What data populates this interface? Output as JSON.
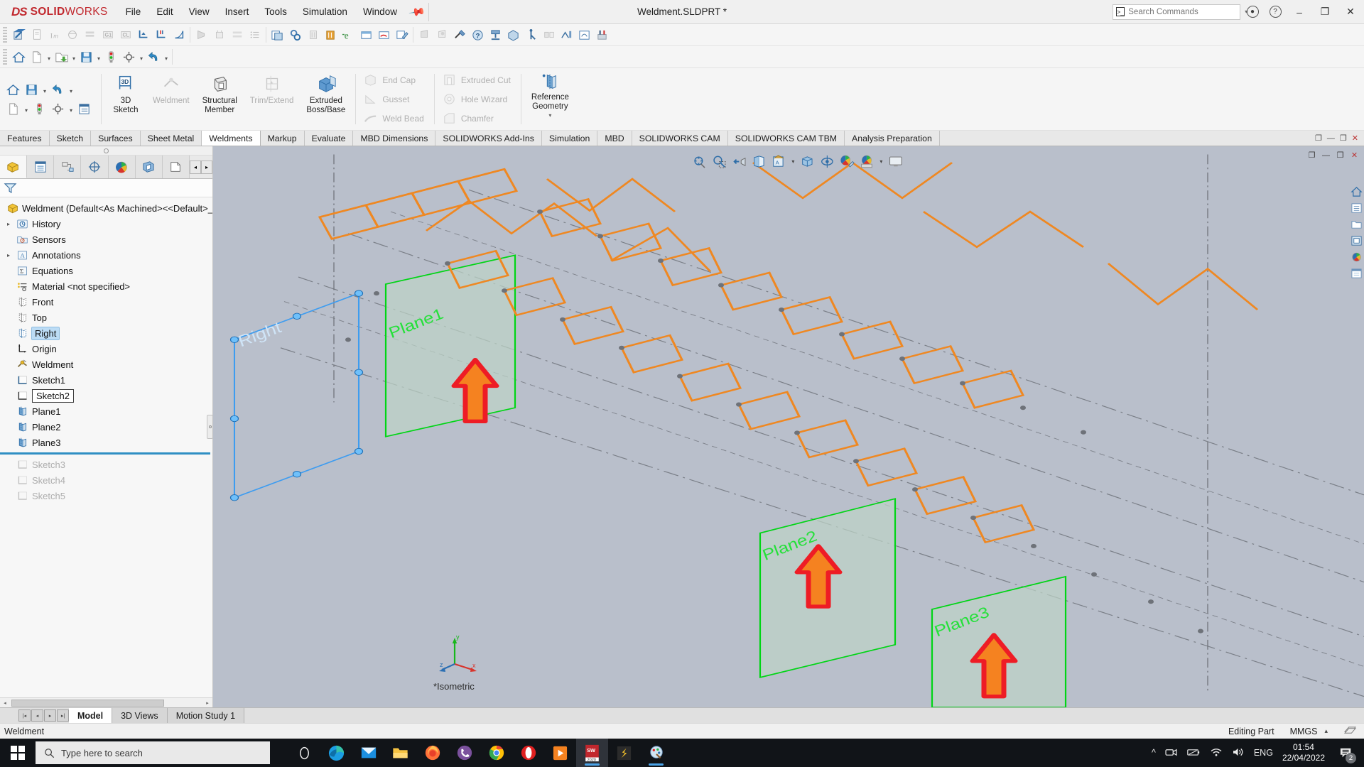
{
  "app": {
    "brand_ds": "DS",
    "brand_solid": "SOLID",
    "brand_works": "WORKS",
    "document_title": "Weldment.SLDPRT *"
  },
  "menubar": {
    "items": [
      {
        "label": "File"
      },
      {
        "label": "Edit"
      },
      {
        "label": "View"
      },
      {
        "label": "Insert"
      },
      {
        "label": "Tools"
      },
      {
        "label": "Simulation"
      },
      {
        "label": "Window"
      }
    ],
    "pin_icon": "pushpin-icon"
  },
  "search": {
    "placeholder": "Search Commands",
    "value": ""
  },
  "window_controls": {
    "account": "account-icon",
    "help": "help-icon",
    "minimize": "–",
    "restore": "❐",
    "close": "✕"
  },
  "command_manager": {
    "quick_access": [
      "home-icon",
      "save-icon",
      "undo-icon",
      "new-doc-icon",
      "rebuild-icon",
      "options-icon"
    ],
    "buttons": [
      {
        "name": "3d-sketch",
        "lines": [
          "3D",
          "Sketch"
        ],
        "enabled": true,
        "icon": "3d-sketch-icon"
      },
      {
        "name": "weldment",
        "lines": [
          "Weldment"
        ],
        "enabled": false,
        "icon": "weldment-icon"
      },
      {
        "name": "structural-member",
        "lines": [
          "Structural",
          "Member"
        ],
        "enabled": true,
        "icon": "structural-member-icon"
      },
      {
        "name": "trim-extend",
        "lines": [
          "Trim/Extend"
        ],
        "enabled": false,
        "icon": "trim-extend-icon"
      },
      {
        "name": "extruded-boss-base",
        "lines": [
          "Extruded",
          "Boss/Base"
        ],
        "enabled": true,
        "icon": "extruded-boss-icon"
      }
    ],
    "small_group_1": [
      {
        "name": "end-cap",
        "label": "End Cap",
        "enabled": false
      },
      {
        "name": "gusset",
        "label": "Gusset",
        "enabled": false
      },
      {
        "name": "weld-bead",
        "label": "Weld Bead",
        "enabled": false
      }
    ],
    "small_group_2": [
      {
        "name": "extruded-cut",
        "label": "Extruded Cut",
        "enabled": false
      },
      {
        "name": "hole-wizard",
        "label": "Hole Wizard",
        "enabled": false
      },
      {
        "name": "chamfer",
        "label": "Chamfer",
        "enabled": false
      }
    ],
    "reference_geometry": {
      "lines": [
        "Reference",
        "Geometry"
      ],
      "enabled": true,
      "dropdown": "▾"
    }
  },
  "ribbon_tabs": {
    "active": "Weldments",
    "items": [
      {
        "label": "Features"
      },
      {
        "label": "Sketch"
      },
      {
        "label": "Surfaces"
      },
      {
        "label": "Sheet Metal"
      },
      {
        "label": "Weldments"
      },
      {
        "label": "Markup"
      },
      {
        "label": "Evaluate"
      },
      {
        "label": "MBD Dimensions"
      },
      {
        "label": "SOLIDWORKS Add-Ins"
      },
      {
        "label": "Simulation"
      },
      {
        "label": "MBD"
      },
      {
        "label": "SOLIDWORKS CAM"
      },
      {
        "label": "SOLIDWORKS CAM TBM"
      },
      {
        "label": "Analysis Preparation"
      }
    ]
  },
  "feature_manager": {
    "panel_tabs": [
      {
        "name": "feature-manager-tab",
        "icon": "feature-tree-icon",
        "active": true
      },
      {
        "name": "property-manager-tab",
        "icon": "property-manager-icon",
        "active": false
      },
      {
        "name": "configuration-manager-tab",
        "icon": "configuration-icon",
        "active": false
      },
      {
        "name": "dimxpert-manager-tab",
        "icon": "dimxpert-icon",
        "active": false
      },
      {
        "name": "display-manager-tab",
        "icon": "display-manager-icon",
        "active": false
      },
      {
        "name": "cam-feature-tree-tab",
        "icon": "cam-tree-icon",
        "active": false
      },
      {
        "name": "cam-operation-tree-tab",
        "icon": "cam-operation-icon",
        "active": false
      }
    ],
    "filter_placeholder": "",
    "root": "Weldment  (Default<As Machined><<Default>_Ph",
    "tree": [
      {
        "label": "History",
        "icon": "history-icon",
        "expandable": true,
        "state": "normal",
        "indent": 1
      },
      {
        "label": "Sensors",
        "icon": "sensors-icon",
        "expandable": false,
        "state": "normal",
        "indent": 1
      },
      {
        "label": "Annotations",
        "icon": "annotations-icon",
        "expandable": true,
        "state": "normal",
        "indent": 1
      },
      {
        "label": "Equations",
        "icon": "equations-icon",
        "expandable": false,
        "state": "normal",
        "indent": 1
      },
      {
        "label": "Material <not specified>",
        "icon": "material-icon",
        "expandable": false,
        "state": "normal",
        "indent": 1
      },
      {
        "label": "Front",
        "icon": "plane-icon",
        "expandable": false,
        "state": "normal",
        "indent": 1
      },
      {
        "label": "Top",
        "icon": "plane-icon",
        "expandable": false,
        "state": "normal",
        "indent": 1
      },
      {
        "label": "Right",
        "icon": "plane-icon",
        "expandable": false,
        "state": "selected",
        "indent": 1
      },
      {
        "label": "Origin",
        "icon": "origin-icon",
        "expandable": false,
        "state": "normal",
        "indent": 1
      },
      {
        "label": "Weldment",
        "icon": "weldment-feature-icon",
        "expandable": false,
        "state": "normal",
        "indent": 1
      },
      {
        "label": "Sketch1",
        "icon": "sketch-icon",
        "expandable": false,
        "state": "normal",
        "indent": 1
      },
      {
        "label": "Sketch2",
        "icon": "sketch-icon",
        "expandable": false,
        "state": "renaming",
        "indent": 1
      },
      {
        "label": "Plane1",
        "icon": "plane-icon",
        "expandable": false,
        "state": "normal",
        "indent": 1
      },
      {
        "label": "Plane2",
        "icon": "plane-icon",
        "expandable": false,
        "state": "normal",
        "indent": 1
      },
      {
        "label": "Plane3",
        "icon": "plane-icon",
        "expandable": false,
        "state": "normal",
        "indent": 1
      },
      {
        "label": "__ROLLBACK__",
        "icon": "",
        "expandable": false,
        "state": "rollback",
        "indent": 0
      },
      {
        "label": "Sketch3",
        "icon": "sketch-icon-dim",
        "expandable": false,
        "state": "dim",
        "indent": 1
      },
      {
        "label": "Sketch4",
        "icon": "sketch-icon-dim",
        "expandable": false,
        "state": "dim",
        "indent": 1
      },
      {
        "label": "Sketch5",
        "icon": "sketch-icon-dim",
        "expandable": false,
        "state": "dim",
        "indent": 1
      }
    ]
  },
  "viewport": {
    "view_orientation_label": "*Isometric",
    "heads_up": [
      {
        "name": "zoom-to-fit-icon"
      },
      {
        "name": "zoom-to-area-icon"
      },
      {
        "name": "previous-view-icon"
      },
      {
        "name": "section-view-icon"
      },
      {
        "name": "view-orientation-icon"
      },
      {
        "name": "display-style-icon"
      },
      {
        "name": "hide-show-items-icon"
      },
      {
        "name": "edit-appearance-icon"
      },
      {
        "name": "apply-scene-icon"
      },
      {
        "name": "view-settings-icon"
      }
    ],
    "right_dock": [
      "view-home-icon",
      "view-list-icon",
      "view-open-icon",
      "view-display-icon",
      "view-appearance-icon",
      "view-custom-icon"
    ],
    "plane_labels": [
      "Right",
      "Plane1",
      "Plane2",
      "Plane3"
    ],
    "triad_axes": [
      "x",
      "y",
      "z"
    ],
    "colors": {
      "background": "#b9bfcb",
      "plane_green": "#00d515",
      "plane_fill": "#bcd2c6",
      "selected_plane_blue": "#3d9cf0",
      "structural_member_orange": "#ef8822",
      "arrow_fill": "#f58220",
      "arrow_stroke": "#ee1c25",
      "construction_gray": "#70747c"
    }
  },
  "bottom_tabs": {
    "active": "Model",
    "items": [
      {
        "label": "Model"
      },
      {
        "label": "3D Views"
      },
      {
        "label": "Motion Study 1"
      }
    ]
  },
  "status_bar": {
    "left": "Weldment",
    "mode": "Editing Part",
    "units": "MMGS",
    "units_caret": "▴",
    "overlay_icon": "overlay-icon"
  },
  "taskbar": {
    "start_icon": "windows-start-icon",
    "search_placeholder": "Type here to search",
    "apps": [
      {
        "name": "cortana-icon"
      },
      {
        "name": "microsoft-edge-icon"
      },
      {
        "name": "mail-icon"
      },
      {
        "name": "file-explorer-icon"
      },
      {
        "name": "firefox-icon"
      },
      {
        "name": "viber-icon"
      },
      {
        "name": "google-chrome-icon"
      },
      {
        "name": "opera-icon"
      },
      {
        "name": "media-player-icon"
      },
      {
        "name": "solidworks-2020-icon"
      },
      {
        "name": "sublime-text-icon"
      },
      {
        "name": "paint-icon"
      }
    ],
    "solidworks_label": "SW",
    "solidworks_year": "2020",
    "tray": {
      "chevron": "^",
      "icons": [
        "camera-icon",
        "battery-icon",
        "wifi-icon",
        "volume-icon"
      ],
      "language": "ENG",
      "time": "01:54",
      "date": "22/04/2022",
      "notification_count": "2"
    }
  }
}
